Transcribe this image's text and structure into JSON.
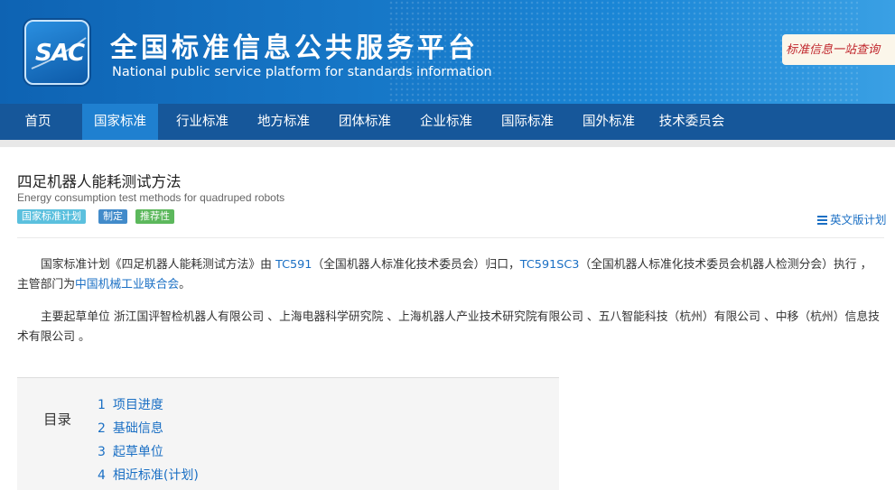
{
  "header": {
    "logo_text": "SAC",
    "title": "全国标准信息公共服务平台",
    "subtitle": "National public service platform  for standards information",
    "slogan": "标准信息一站查询",
    "colors": {
      "header_blue": "#1779c9",
      "nav_blue": "#16579a",
      "nav_active": "#1f80d0"
    }
  },
  "nav": {
    "items": [
      {
        "label": "首页"
      },
      {
        "label": "国家标准"
      },
      {
        "label": "行业标准"
      },
      {
        "label": "地方标准"
      },
      {
        "label": "团体标准"
      },
      {
        "label": "企业标准"
      },
      {
        "label": "国际标准"
      },
      {
        "label": "国外标准"
      },
      {
        "label": "技术委员会"
      }
    ],
    "active": "国家标准"
  },
  "standard": {
    "title_cn": "四足机器人能耗测试方法",
    "title_en": "Energy consumption test methods for quadruped robots",
    "badges": [
      "国家标准计划",
      "制定",
      "推荐性"
    ],
    "badge_colors": [
      "#5bc0de",
      "#428bca",
      "#5cb85c"
    ],
    "english_plan_link": "英文版计划"
  },
  "description": {
    "p1_a": "国家标准计划《四足机器人能耗测试方法》由 ",
    "tc1": "TC591",
    "p1_b": "（全国机器人标准化技术委员会）归口，",
    "tc2": "TC591SC3",
    "p1_c": "（全国机器人标准化技术委员会机器人检测分会）执行 ，主管部门为",
    "dept": "中国机械工业联合会",
    "p1_d": "。",
    "p2": "主要起草单位 浙江国评智检机器人有限公司 、上海电器科学研究院 、上海机器人产业技术研究院有限公司 、五八智能科技（杭州）有限公司 、中移（杭州）信息技术有限公司 。"
  },
  "toc": {
    "label": "目录",
    "items": [
      {
        "num": "1",
        "label": "项目进度"
      },
      {
        "num": "2",
        "label": "基础信息"
      },
      {
        "num": "3",
        "label": "起草单位"
      },
      {
        "num": "4",
        "label": "相近标准(计划)"
      }
    ]
  }
}
